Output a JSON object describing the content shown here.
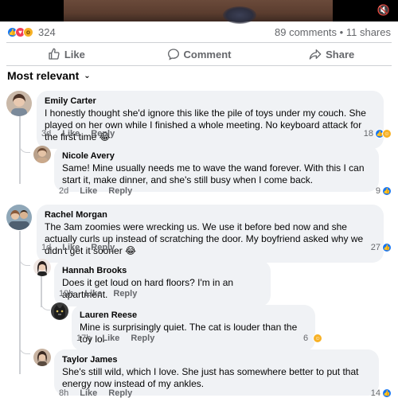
{
  "post": {
    "reaction_count": "324",
    "comments_count": "89 comments",
    "separator": "•",
    "shares_count": "11 shares",
    "reactions": [
      "like",
      "love",
      "wow"
    ]
  },
  "actions": {
    "like": "Like",
    "comment": "Comment",
    "share": "Share"
  },
  "sort_label": "Most relevant",
  "labels": {
    "like": "Like",
    "reply": "Reply"
  },
  "comments": [
    {
      "author": "Emily Carter",
      "text": "I honestly thought she'd ignore this like the pile of toys under my couch. She played on her own while I finished a whole meeting. No keyboard attack for the first time 😂",
      "time": "3d",
      "reactions": "18"
    },
    {
      "author": "Nicole Avery",
      "text": "Same! Mine usually needs me to wave the wand forever. With this I can start it, make dinner, and she's still busy when I come back.",
      "time": "2d",
      "reactions": "9"
    },
    {
      "author": "Rachel Morgan",
      "text": "The 3am zoomies were wrecking us. We use it before bed now and she actually curls up instead of scratching the door. My boyfriend asked why we didn't get it sooner 😂",
      "time": "1d",
      "reactions": "27"
    },
    {
      "author": "Hannah Brooks",
      "text": "Does it get loud on hard floors? I'm in an apartment.",
      "time": "19h",
      "reactions": ""
    },
    {
      "author": "Lauren Reese",
      "text": "Mine is surprisingly quiet. The cat is louder than the toy lol",
      "time": "17h",
      "reactions": "6"
    },
    {
      "author": "Taylor James",
      "text": "She's still wild, which I love. She just has somewhere better to put that energy now instead of my ankles.",
      "time": "8h",
      "reactions": "14"
    }
  ],
  "colors": {
    "accent": "#1877f2",
    "bubble": "#f0f2f5",
    "muted": "#65676b"
  }
}
